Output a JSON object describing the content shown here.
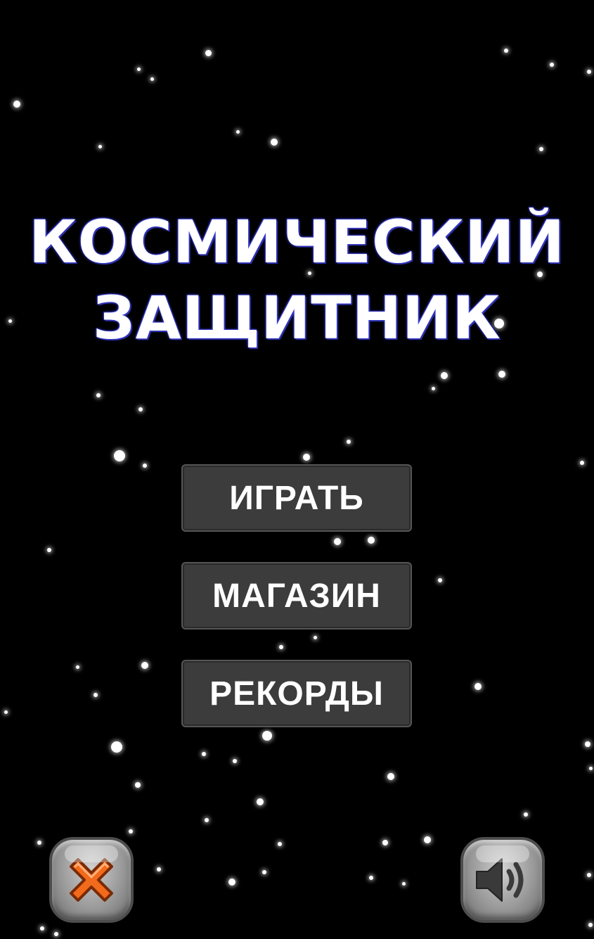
{
  "title": {
    "line1": "КОСМИЧЕСКИЙ",
    "line2": "ЗАЩИТНИК"
  },
  "menu": {
    "play_label": "ИГРАТЬ",
    "shop_label": "МАГАЗИН",
    "records_label": "РЕКОРДЫ"
  },
  "controls": {
    "close_icon": "close-x-icon",
    "sound_icon": "speaker-icon"
  },
  "colors": {
    "background": "#000000",
    "button": "#3c3c3c",
    "title_outline": "#3b3fd8",
    "close_x": "#f26a1b"
  }
}
